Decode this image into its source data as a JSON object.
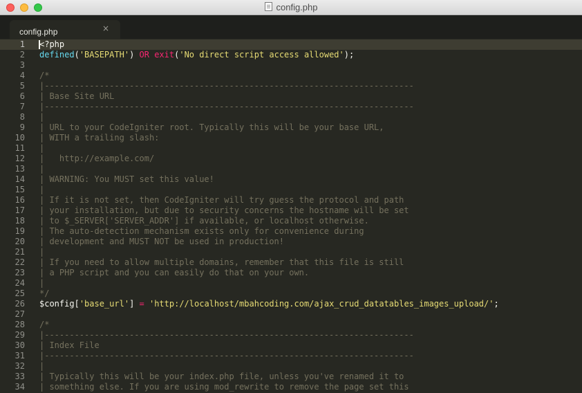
{
  "window": {
    "title": "config.php"
  },
  "tab": {
    "label": "config.php",
    "close_glyph": "×"
  },
  "editor": {
    "current_line": 1,
    "lines": [
      {
        "n": "1",
        "segs": [
          [
            "c-punc",
            "<?php"
          ]
        ]
      },
      {
        "n": "2",
        "segs": [
          [
            "c-func",
            "defined"
          ],
          [
            "c-punc",
            "("
          ],
          [
            "c-str",
            "'BASEPATH'"
          ],
          [
            "c-punc",
            ") "
          ],
          [
            "c-kw",
            "OR"
          ],
          [
            "c-punc",
            " "
          ],
          [
            "c-kw",
            "exit"
          ],
          [
            "c-punc",
            "("
          ],
          [
            "c-str",
            "'No direct script access allowed'"
          ],
          [
            "c-punc",
            ");"
          ]
        ]
      },
      {
        "n": "3",
        "segs": []
      },
      {
        "n": "4",
        "segs": [
          [
            "c-comment",
            "/*"
          ]
        ]
      },
      {
        "n": "5",
        "segs": [
          [
            "c-comment",
            "|--------------------------------------------------------------------------"
          ]
        ]
      },
      {
        "n": "6",
        "segs": [
          [
            "c-comment",
            "| Base Site URL"
          ]
        ]
      },
      {
        "n": "7",
        "segs": [
          [
            "c-comment",
            "|--------------------------------------------------------------------------"
          ]
        ]
      },
      {
        "n": "8",
        "segs": [
          [
            "c-comment",
            "|"
          ]
        ]
      },
      {
        "n": "9",
        "segs": [
          [
            "c-comment",
            "| URL to your CodeIgniter root. Typically this will be your base URL,"
          ]
        ]
      },
      {
        "n": "10",
        "segs": [
          [
            "c-comment",
            "| WITH a trailing slash:"
          ]
        ]
      },
      {
        "n": "11",
        "segs": [
          [
            "c-comment",
            "|"
          ]
        ]
      },
      {
        "n": "12",
        "segs": [
          [
            "c-comment",
            "|   http://example.com/"
          ]
        ]
      },
      {
        "n": "13",
        "segs": [
          [
            "c-comment",
            "|"
          ]
        ]
      },
      {
        "n": "14",
        "segs": [
          [
            "c-comment",
            "| WARNING: You MUST set this value!"
          ]
        ]
      },
      {
        "n": "15",
        "segs": [
          [
            "c-comment",
            "|"
          ]
        ]
      },
      {
        "n": "16",
        "segs": [
          [
            "c-comment",
            "| If it is not set, then CodeIgniter will try guess the protocol and path"
          ]
        ]
      },
      {
        "n": "17",
        "segs": [
          [
            "c-comment",
            "| your installation, but due to security concerns the hostname will be set"
          ]
        ]
      },
      {
        "n": "18",
        "segs": [
          [
            "c-comment",
            "| to $_SERVER['SERVER_ADDR'] if available, or localhost otherwise."
          ]
        ]
      },
      {
        "n": "19",
        "segs": [
          [
            "c-comment",
            "| The auto-detection mechanism exists only for convenience during"
          ]
        ]
      },
      {
        "n": "20",
        "segs": [
          [
            "c-comment",
            "| development and MUST NOT be used in production!"
          ]
        ]
      },
      {
        "n": "21",
        "segs": [
          [
            "c-comment",
            "|"
          ]
        ]
      },
      {
        "n": "22",
        "segs": [
          [
            "c-comment",
            "| If you need to allow multiple domains, remember that this file is still"
          ]
        ]
      },
      {
        "n": "23",
        "segs": [
          [
            "c-comment",
            "| a PHP script and you can easily do that on your own."
          ]
        ]
      },
      {
        "n": "24",
        "segs": [
          [
            "c-comment",
            "|"
          ]
        ]
      },
      {
        "n": "25",
        "segs": [
          [
            "c-comment",
            "*/"
          ]
        ]
      },
      {
        "n": "26",
        "segs": [
          [
            "c-var",
            "$config"
          ],
          [
            "c-punc",
            "["
          ],
          [
            "c-str",
            "'base_url'"
          ],
          [
            "c-punc",
            "] "
          ],
          [
            "c-kw",
            "="
          ],
          [
            "c-punc",
            " "
          ],
          [
            "c-str",
            "'http://localhost/mbahcoding.com/ajax_crud_datatables_images_upload/'"
          ],
          [
            "c-punc",
            ";"
          ]
        ]
      },
      {
        "n": "27",
        "segs": []
      },
      {
        "n": "28",
        "segs": [
          [
            "c-comment",
            "/*"
          ]
        ]
      },
      {
        "n": "29",
        "segs": [
          [
            "c-comment",
            "|--------------------------------------------------------------------------"
          ]
        ]
      },
      {
        "n": "30",
        "segs": [
          [
            "c-comment",
            "| Index File"
          ]
        ]
      },
      {
        "n": "31",
        "segs": [
          [
            "c-comment",
            "|--------------------------------------------------------------------------"
          ]
        ]
      },
      {
        "n": "32",
        "segs": [
          [
            "c-comment",
            "|"
          ]
        ]
      },
      {
        "n": "33",
        "segs": [
          [
            "c-comment",
            "| Typically this will be your index.php file, unless you've renamed it to"
          ]
        ]
      },
      {
        "n": "34",
        "segs": [
          [
            "c-comment",
            "| something else. If you are using mod_rewrite to remove the page set this"
          ]
        ]
      }
    ]
  }
}
